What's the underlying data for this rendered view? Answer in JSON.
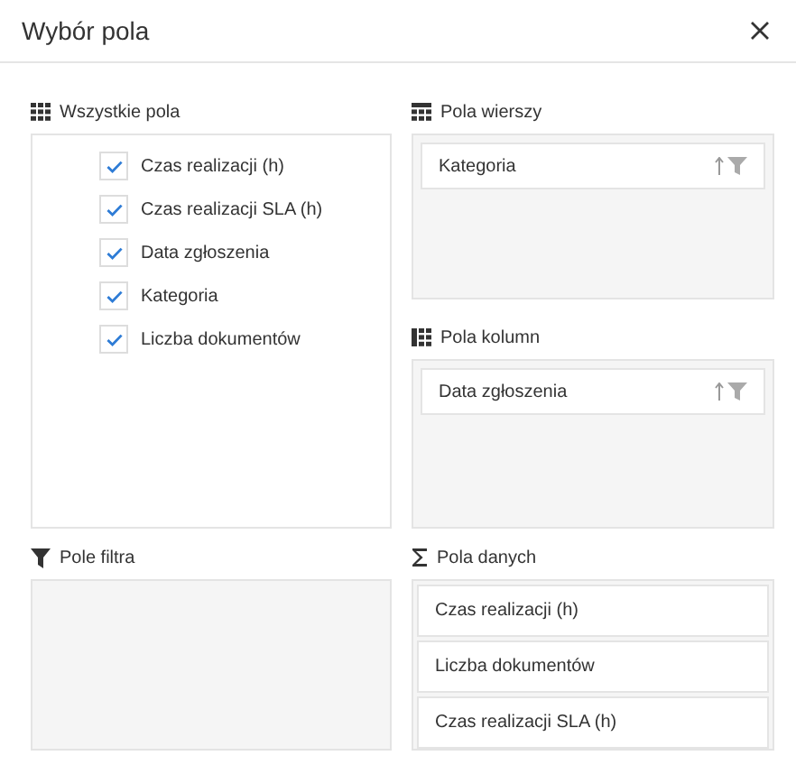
{
  "window": {
    "title": "Wybór pola"
  },
  "all_fields": {
    "label": "Wszystkie pola",
    "items": [
      {
        "label": "Czas realizacji (h)",
        "checked": true
      },
      {
        "label": "Czas realizacji SLA (h)",
        "checked": true
      },
      {
        "label": "Data zgłoszenia",
        "checked": true
      },
      {
        "label": "Kategoria",
        "checked": true
      },
      {
        "label": "Liczba dokumentów",
        "checked": true
      }
    ]
  },
  "row_fields": {
    "label": "Pola wierszy",
    "items": [
      {
        "label": "Kategoria"
      }
    ]
  },
  "column_fields": {
    "label": "Pola kolumn",
    "items": [
      {
        "label": "Data zgłoszenia"
      }
    ]
  },
  "filter_fields": {
    "label": "Pole filtra"
  },
  "data_fields": {
    "label": "Pola danych",
    "items": [
      {
        "label": "Czas realizacji (h)"
      },
      {
        "label": "Liczba dokumentów"
      },
      {
        "label": "Czas realizacji SLA (h)"
      }
    ]
  }
}
